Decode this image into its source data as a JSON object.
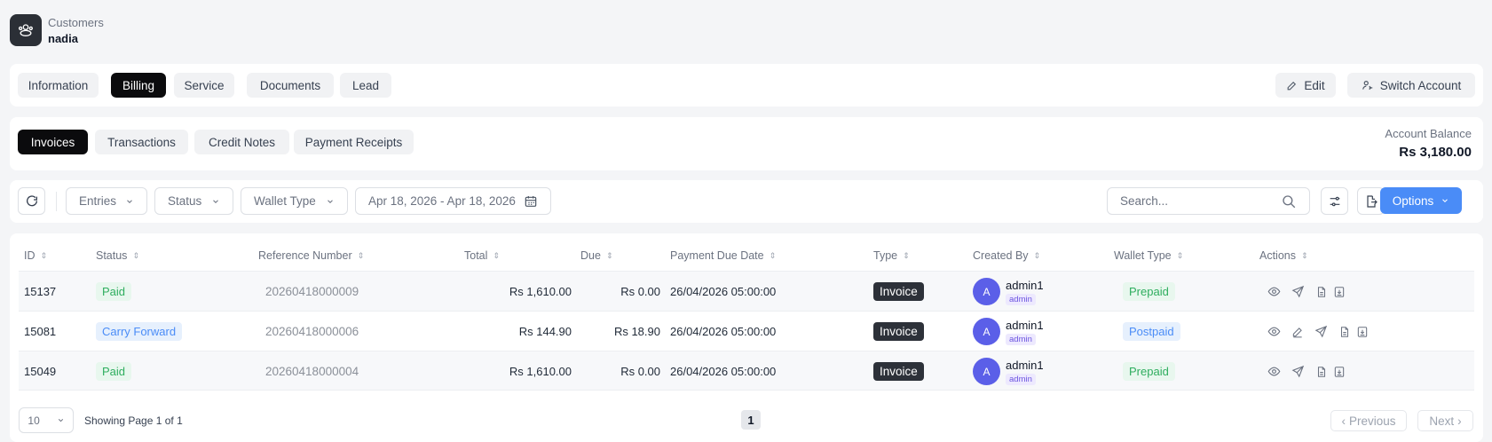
{
  "header": {
    "section": "Customers",
    "customer_name": "nadia"
  },
  "main_tabs": [
    {
      "label": "Information"
    },
    {
      "label": "Billing",
      "active": true
    },
    {
      "label": "Service"
    },
    {
      "label": "Documents"
    },
    {
      "label": "Lead"
    }
  ],
  "actions": {
    "edit_label": "Edit",
    "switch_label": "Switch Account"
  },
  "sub_tabs": [
    {
      "label": "Invoices",
      "active": true
    },
    {
      "label": "Transactions"
    },
    {
      "label": "Credit Notes"
    },
    {
      "label": "Payment Receipts"
    }
  ],
  "balance": {
    "label": "Account Balance",
    "value": "Rs 3,180.00"
  },
  "filters": {
    "entries": "Entries",
    "status": "Status",
    "wallet_type": "Wallet Type",
    "date_range": "Apr 18, 2026 - Apr 18, 2026",
    "search_placeholder": "Search...",
    "options_label": "Options"
  },
  "table": {
    "columns": [
      "ID",
      "Status",
      "Reference Number",
      "Total",
      "Due",
      "Payment Due Date",
      "Type",
      "Created By",
      "Wallet Type",
      "Actions"
    ],
    "rows": [
      {
        "id": "15137",
        "status": "Paid",
        "reference": "20260418000009",
        "total": "Rs 1,610.00",
        "due": "Rs 0.00",
        "due_date": "26/04/2026 05:00:00",
        "type": "Invoice",
        "avatar": "A",
        "creator": "admin1",
        "role": "admin",
        "wallet": "Prepaid"
      },
      {
        "id": "15081",
        "status": "Carry Forward",
        "reference": "20260418000006",
        "total": "Rs 144.90",
        "due": "Rs 18.90",
        "due_date": "26/04/2026 05:00:00",
        "type": "Invoice",
        "avatar": "A",
        "creator": "admin1",
        "role": "admin",
        "wallet": "Postpaid"
      },
      {
        "id": "15049",
        "status": "Paid",
        "reference": "20260418000004",
        "total": "Rs 1,610.00",
        "due": "Rs 0.00",
        "due_date": "26/04/2026 05:00:00",
        "type": "Invoice",
        "avatar": "A",
        "creator": "admin1",
        "role": "admin",
        "wallet": "Prepaid"
      }
    ]
  },
  "footer": {
    "per_page": "10",
    "showing": "Showing Page 1 of 1",
    "current_page": "1",
    "previous_label": "Previous",
    "next_label": "Next"
  }
}
